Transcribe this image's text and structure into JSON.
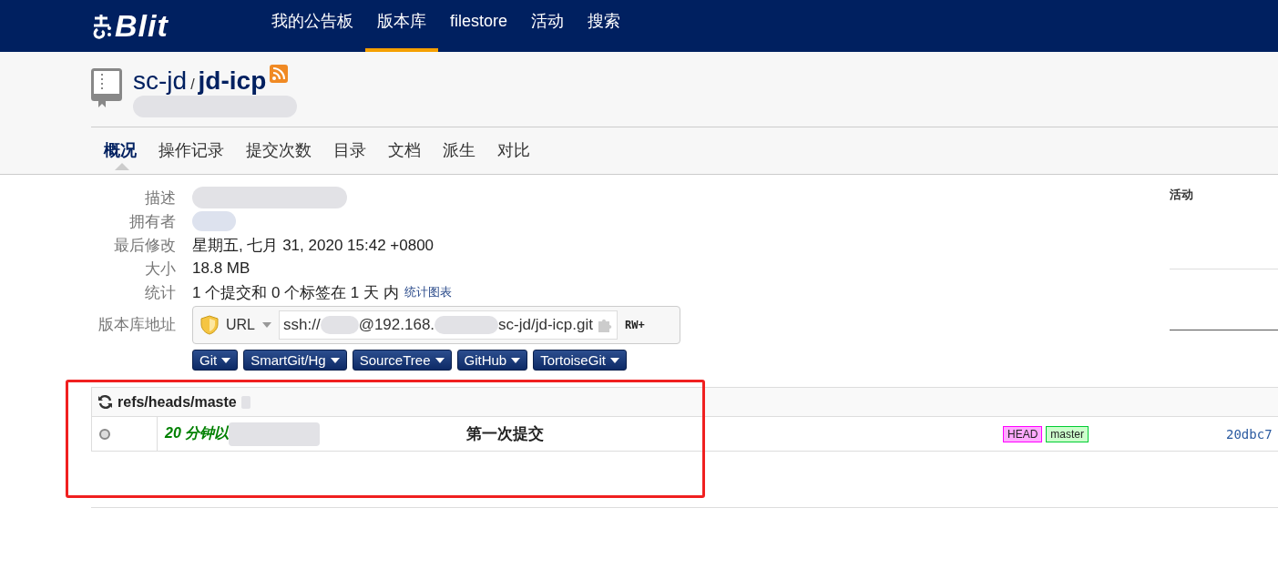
{
  "nav": {
    "logo": "Blit",
    "items": [
      {
        "label": "我的公告板",
        "selected": false
      },
      {
        "label": "版本库",
        "selected": true
      },
      {
        "label": "filestore",
        "selected": false
      },
      {
        "label": "活动",
        "selected": false
      },
      {
        "label": "搜索",
        "selected": false
      }
    ]
  },
  "repo": {
    "owner": "sc-jd",
    "separator": "/",
    "name": "jd-icp"
  },
  "tabs": [
    {
      "label": "概况",
      "selected": true
    },
    {
      "label": "操作记录",
      "selected": false
    },
    {
      "label": "提交次数",
      "selected": false
    },
    {
      "label": "目录",
      "selected": false
    },
    {
      "label": "文档",
      "selected": false
    },
    {
      "label": "派生",
      "selected": false
    },
    {
      "label": "对比",
      "selected": false
    }
  ],
  "summary": [
    {
      "label": "描述",
      "kind": "hidden"
    },
    {
      "label": "拥有者",
      "kind": "hidden"
    },
    {
      "label": "最后修改",
      "kind": "text",
      "value": "星期五, 七月 31, 2020 15:42 +0800"
    },
    {
      "label": "大小",
      "kind": "text",
      "value": "18.8 MB"
    },
    {
      "label": "统计",
      "kind": "stats",
      "value": "1 个提交和 0 个标签在 1 天 内",
      "link": "统计图表"
    },
    {
      "label": "版本库地址",
      "kind": "url",
      "protocol": "URL",
      "url_parts": [
        "ssh://",
        "@192.168.",
        "sc-jd/jd-icp.git"
      ],
      "access": "RW+"
    }
  ],
  "clients": [
    "Git",
    "SmartGit/Hg",
    "SourceTree",
    "GitHub",
    "TortoiseGit"
  ],
  "activity": {
    "title": "活动"
  },
  "commits": {
    "ref": "refs/heads/maste",
    "rows": [
      {
        "age": "20 分钟以",
        "message": "第一次提交",
        "refs": [
          {
            "label": "HEAD",
            "color": "#ffaaff",
            "kind": "head"
          },
          {
            "label": "master",
            "color": "#ccffcc",
            "kind": "branch"
          }
        ],
        "hash": "20dbc7"
      }
    ]
  }
}
